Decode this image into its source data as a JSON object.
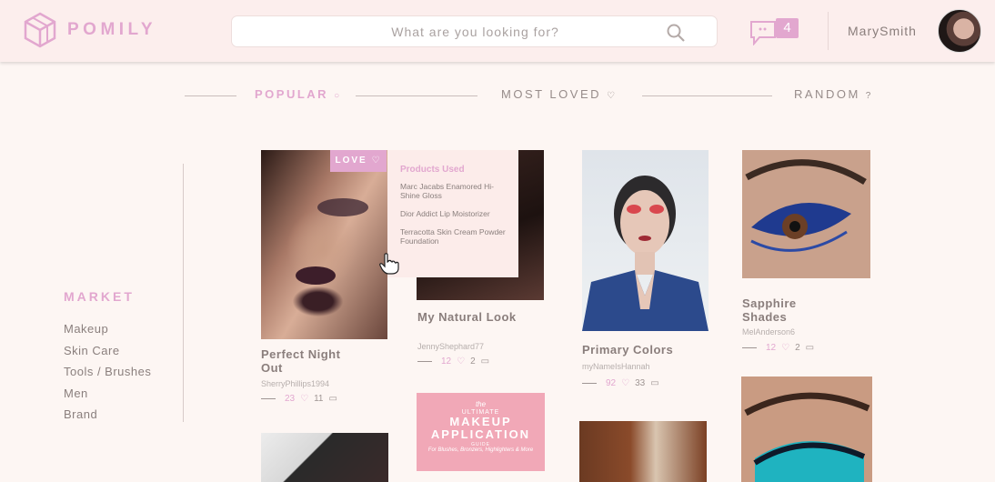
{
  "header": {
    "brand": "POMILY",
    "search_placeholder": "What are you looking for?",
    "message_count": "4",
    "username": "MarySmith"
  },
  "tabs": [
    {
      "label": "POPULAR",
      "glyph": "○",
      "active": true
    },
    {
      "label": "MOST LOVED",
      "glyph": "♡",
      "active": false
    },
    {
      "label": "RANDOM",
      "glyph": "?",
      "active": false
    }
  ],
  "sidebar": {
    "title": "MARKET",
    "items": [
      "Makeup",
      "Skin Care",
      "Tools / Brushes",
      "Men",
      "Brand"
    ]
  },
  "cards": [
    {
      "title": "Perfect Night Out",
      "user": "SherryPhillips1994",
      "likes": "23",
      "comments": "11"
    },
    {
      "title": "My Natural Look",
      "user": "JennyShephard77",
      "likes": "12",
      "comments": "2"
    },
    {
      "title": "Primary Colors",
      "user": "myNameIsHannah",
      "likes": "92",
      "comments": "33"
    },
    {
      "title": "Sapphire Shades",
      "user": "MelAnderson6",
      "likes": "12",
      "comments": "2"
    }
  ],
  "hover": {
    "love_label": "LOVE",
    "products_title": "Products Used",
    "products": [
      "Marc Jacabs Enamored Hi-Shine Gloss",
      "Dior Addict Lip Moistorizer",
      "Terracotta Skin Cream Powder Foundation"
    ]
  },
  "poster": {
    "the": "the",
    "ultimate": "ULTIMATE",
    "line1": "MAKEUP",
    "line2": "APPLICATION",
    "guide": "GUIDE",
    "sub": "For Blushes, Bronzers, Highlighters & More"
  },
  "colors": {
    "accent": "#e2a7cf",
    "header_bg": "#fceeed",
    "page_bg": "#fdf6f3",
    "poster_bg": "#f1a8b7"
  },
  "icons": {
    "logo": "cube-logo-icon",
    "search": "search-icon",
    "messages": "chat-bubble-icon",
    "like": "heart-icon",
    "comment": "comment-icon",
    "cursor": "hand-pointer-icon"
  }
}
